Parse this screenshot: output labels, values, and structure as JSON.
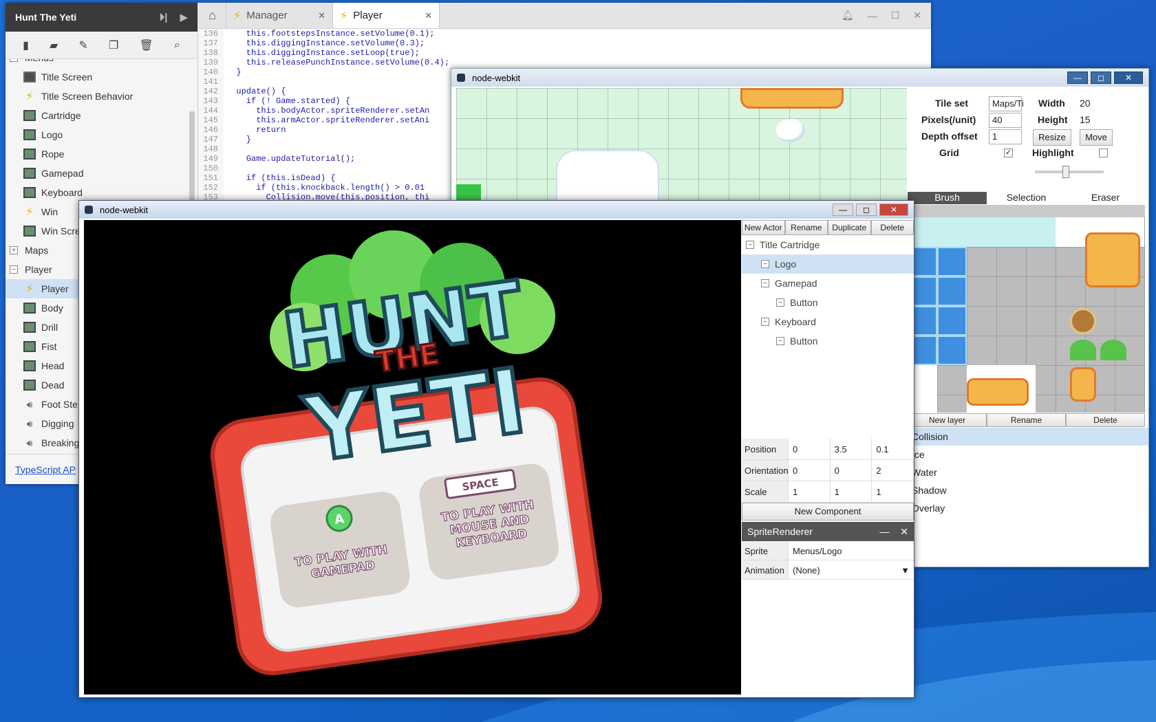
{
  "colors": {
    "desktop": "#1a5fc6",
    "accent_selection": "#cfe2f5",
    "bolt": "#e0b300"
  },
  "sidebar": {
    "title": "Hunt The Yeti",
    "header_icons": [
      "step-play-icon",
      "play-icon"
    ],
    "toolbar_icons": [
      "new-file-icon",
      "open-folder-icon",
      "rename-icon",
      "duplicate-icon",
      "trash-icon",
      "search-icon"
    ],
    "groups": [
      {
        "label": "Menus",
        "items": [
          {
            "label": "Title Screen",
            "icon": "scene-icon"
          },
          {
            "label": "Title Screen Behavior",
            "icon": "bolt-icon"
          },
          {
            "label": "Cartridge",
            "icon": "sprite-icon"
          },
          {
            "label": "Logo",
            "icon": "sprite-icon"
          },
          {
            "label": "Rope",
            "icon": "sprite-icon"
          },
          {
            "label": "Gamepad",
            "icon": "sprite-icon"
          },
          {
            "label": "Keyboard",
            "icon": "sprite-icon"
          },
          {
            "label": "Win",
            "icon": "bolt-icon"
          },
          {
            "label": "Win Scre",
            "icon": "sprite-icon"
          }
        ]
      },
      {
        "label": "Maps",
        "items": []
      },
      {
        "label": "Player",
        "items": [
          {
            "label": "Player",
            "icon": "bolt-icon"
          },
          {
            "label": "Body",
            "icon": "sprite-icon"
          },
          {
            "label": "Drill",
            "icon": "sprite-icon"
          },
          {
            "label": "Fist",
            "icon": "sprite-icon"
          },
          {
            "label": "Head",
            "icon": "sprite-icon"
          },
          {
            "label": "Dead",
            "icon": "sprite-icon"
          },
          {
            "label": "Foot Ste",
            "icon": "sound-icon"
          },
          {
            "label": "Digging",
            "icon": "sound-icon"
          },
          {
            "label": "Breaking",
            "icon": "sound-icon"
          }
        ]
      }
    ],
    "footer_link": "TypeScript AP"
  },
  "tabs": {
    "items": [
      {
        "label": "Manager"
      },
      {
        "label": "Player"
      }
    ]
  },
  "code": [
    {
      "n": "136",
      "t": "    this.footstepsInstance.setVolume(0.1);"
    },
    {
      "n": "137",
      "t": "    this.diggingInstance.setVolume(0.3);"
    },
    {
      "n": "138",
      "t": "    this.diggingInstance.setLoop(true);"
    },
    {
      "n": "139",
      "t": "    this.releasePunchInstance.setVolume(0.4);"
    },
    {
      "n": "140",
      "t": "  }"
    },
    {
      "n": "141",
      "t": ""
    },
    {
      "n": "142",
      "t": "  update() {"
    },
    {
      "n": "143",
      "t": "    if (! Game.started) {"
    },
    {
      "n": "144",
      "t": "      this.bodyActor.spriteRenderer.setAn"
    },
    {
      "n": "145",
      "t": "      this.armActor.spriteRenderer.setAni"
    },
    {
      "n": "146",
      "t": "      return"
    },
    {
      "n": "147",
      "t": "    }"
    },
    {
      "n": "148",
      "t": ""
    },
    {
      "n": "149",
      "t": "    Game.updateTutorial();"
    },
    {
      "n": "150",
      "t": ""
    },
    {
      "n": "151",
      "t": "    if (this.isDead) {"
    },
    {
      "n": "152",
      "t": "      if (this.knockback.length() > 0.01"
    },
    {
      "n": "153",
      "t": "        Collision.move(this.position, thi"
    }
  ],
  "tile_window": {
    "title": "node-webkit",
    "props": {
      "tileset_label": "Tile set",
      "tileset_value": "Maps/Ti",
      "width_label": "Width",
      "width_value": "20",
      "pixels_label": "Pixels(/unit)",
      "pixels_value": "40",
      "height_label": "Height",
      "height_value": "15",
      "depth_label": "Depth offset",
      "depth_value": "1",
      "resize": "Resize",
      "move": "Move",
      "grid_label": "Grid",
      "grid_checked": "✓",
      "highlight_label": "Highlight"
    },
    "tools": [
      "Brush",
      "Selection",
      "Eraser"
    ],
    "layer_buttons": [
      "New layer",
      "Rename",
      "Delete"
    ],
    "layers": [
      "Collision",
      "Ice",
      "Water",
      "Shadow",
      "Overlay"
    ]
  },
  "game_window": {
    "title": "node-webkit",
    "scene_buttons": [
      "New Actor",
      "Rename",
      "Duplicate",
      "Delete"
    ],
    "scene_tree": [
      {
        "label": "Title Cartridge",
        "depth": 0
      },
      {
        "label": "Logo",
        "depth": 1
      },
      {
        "label": "Gamepad",
        "depth": 1
      },
      {
        "label": "Button",
        "depth": 2
      },
      {
        "label": "Keyboard",
        "depth": 1
      },
      {
        "label": "Button",
        "depth": 2
      }
    ],
    "transform": [
      {
        "label": "Position",
        "values": [
          "0",
          "3.5",
          "0.1"
        ]
      },
      {
        "label": "Orientation",
        "values": [
          "0",
          "0",
          "2"
        ]
      },
      {
        "label": "Scale",
        "values": [
          "1",
          "1",
          "1"
        ]
      }
    ],
    "new_component": "New Component",
    "component": {
      "title": "SpriteRenderer",
      "sprite_label": "Sprite",
      "sprite_value": "Menus/Logo",
      "animation_label": "Animation",
      "animation_value": "(None)"
    },
    "game_text": {
      "logo_hunt": "HUNT",
      "logo_the": "THE",
      "logo_yeti": "YETI",
      "gamepad_key": "A",
      "space_key": "SPACE",
      "gamepad_line1": "TO PLAY WITH",
      "gamepad_line2": "GAMEPAD",
      "kb_line1": "TO PLAY WITH",
      "kb_line2": "MOUSE AND",
      "kb_line3": "KEYBOARD"
    }
  }
}
